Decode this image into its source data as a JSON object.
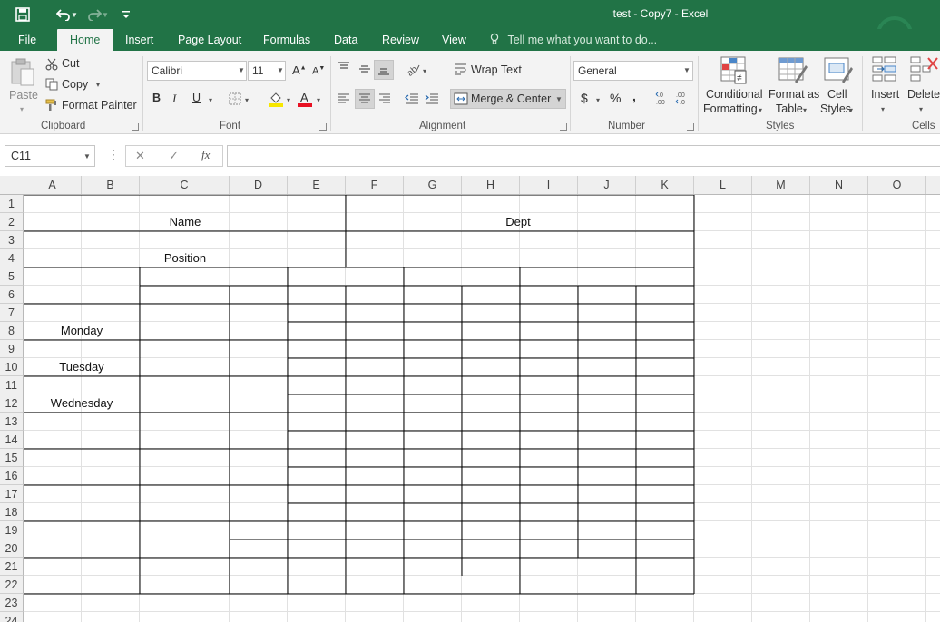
{
  "window": {
    "title": "test - Copy7 - Excel"
  },
  "quick_access": {
    "save_icon": "save-icon",
    "undo_icon": "undo-icon",
    "redo_icon": "redo-icon",
    "customize_icon": "customize-qat-icon"
  },
  "tabs": [
    "File",
    "Home",
    "Insert",
    "Page Layout",
    "Formulas",
    "Data",
    "Review",
    "View"
  ],
  "active_tab": "Home",
  "tell_me": "Tell me what you want to do...",
  "clipboard": {
    "paste": "Paste",
    "cut": "Cut",
    "copy": "Copy",
    "format_painter": "Format Painter",
    "label": "Clipboard"
  },
  "font": {
    "name": "Calibri",
    "size": "11",
    "bold": "B",
    "italic": "I",
    "underline": "U",
    "label": "Font"
  },
  "alignment": {
    "wrap_text": "Wrap Text",
    "merge_center": "Merge & Center",
    "label": "Alignment"
  },
  "number": {
    "format": "General",
    "currency": "$",
    "percent": "%",
    "comma": ",",
    "label": "Number"
  },
  "styles": {
    "conditional": [
      "Conditional",
      "Formatting"
    ],
    "format_table": [
      "Format as",
      "Table"
    ],
    "cell_styles": [
      "Cell",
      "Styles"
    ],
    "label": "Styles"
  },
  "cells": {
    "insert": "Insert",
    "delete": "Delete",
    "label": "Cells"
  },
  "formula_bar": {
    "name_box": "C11",
    "cancel": "✕",
    "enter": "✓",
    "fx": "fx",
    "content": ""
  },
  "columns": [
    "A",
    "B",
    "C",
    "D",
    "E",
    "F",
    "G",
    "H",
    "I",
    "J",
    "K",
    "L",
    "M",
    "N",
    "O"
  ],
  "rows": [
    "1",
    "2",
    "3",
    "4",
    "5",
    "6",
    "7",
    "8",
    "9",
    "10",
    "11",
    "12",
    "13",
    "14",
    "15",
    "16",
    "17",
    "18",
    "19",
    "20",
    "21",
    "22",
    "23",
    "24"
  ],
  "cells_text": {
    "name": "Name",
    "dept": "Dept",
    "position": "Position",
    "monday": "Monday",
    "tuesday": "Tuesday",
    "wednesday": "Wednesday"
  }
}
